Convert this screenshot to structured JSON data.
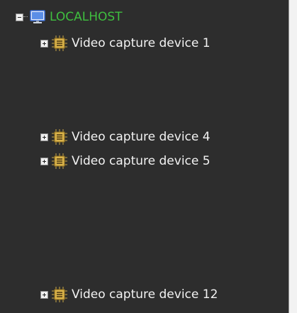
{
  "tree": {
    "root": {
      "label": "LOCALHOST",
      "icon": "monitor-icon",
      "expanded": true,
      "color": "#3fbf3f"
    },
    "devices": [
      {
        "label": "Video capture device 1",
        "icon": "chip-icon",
        "expanded": false
      },
      {
        "label": "Video capture device 4",
        "icon": "chip-icon",
        "expanded": false
      },
      {
        "label": "Video capture device 5",
        "icon": "chip-icon",
        "expanded": false
      },
      {
        "label": "Video capture device 12",
        "icon": "chip-icon",
        "expanded": false
      }
    ]
  },
  "colors": {
    "panel_background": "#2d2d2d",
    "device_text": "#f2f2f2",
    "host_text": "#3fbf3f"
  }
}
